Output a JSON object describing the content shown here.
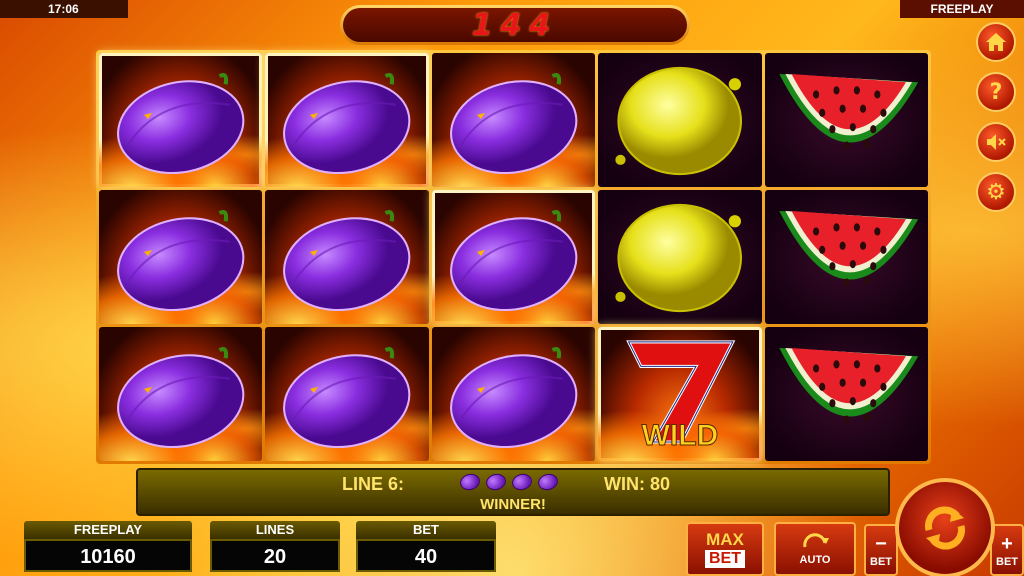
{
  "status": {
    "time": "17:06",
    "mode": "FREEPLAY"
  },
  "top_win": {
    "value": "144"
  },
  "reels": [
    [
      "plum",
      "plum",
      "plum"
    ],
    [
      "plum",
      "plum",
      "plum"
    ],
    [
      "plum",
      "plum",
      "plum"
    ],
    [
      "lemon",
      "lemon",
      "wild"
    ],
    [
      "watermelon",
      "watermelon",
      "watermelon"
    ]
  ],
  "highlighted_cells": [
    [
      0,
      0
    ],
    [
      1,
      0
    ],
    [
      2,
      1
    ],
    [
      3,
      2
    ]
  ],
  "wild_label": "WILD",
  "info": {
    "line_label": "LINE 6:",
    "win_label": "WIN: 80",
    "winner_text": "WINNER!",
    "line_symbol_count": 4
  },
  "stats": {
    "freeplay": {
      "label": "FREEPLAY",
      "value": "10160"
    },
    "lines": {
      "label": "LINES",
      "value": "20"
    },
    "bet": {
      "label": "BET",
      "value": "40"
    }
  },
  "buttons": {
    "max_bet": {
      "line1": "MAX",
      "line2": "BET"
    },
    "auto": "AUTO",
    "bet_minus": {
      "sign": "−",
      "label": "BET"
    },
    "bet_plus": {
      "sign": "+",
      "label": "BET"
    }
  },
  "side_icons": [
    "home-icon",
    "help-icon",
    "sound-off-icon",
    "settings-icon"
  ],
  "colors": {
    "accent": "#ffe36a",
    "win_red": "#e8161a",
    "plum": "#8a2ee0"
  }
}
